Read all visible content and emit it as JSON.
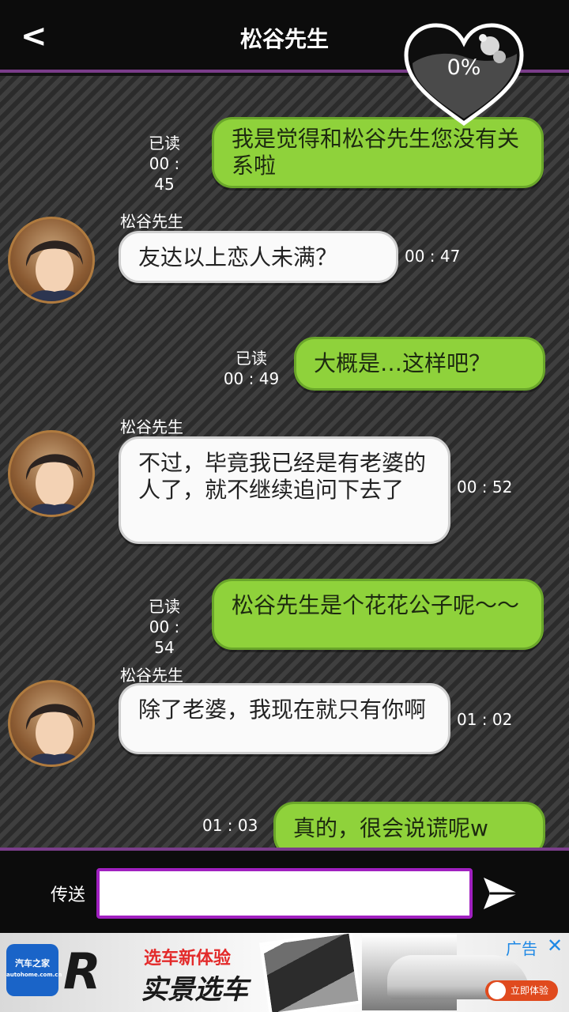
{
  "header": {
    "title": "松谷先生",
    "affection_percent": "0%",
    "affection_value": 0
  },
  "messages": [
    {
      "dir": "out",
      "text": "我是觉得和松谷先生您没有关系啦",
      "read": "已读",
      "time": "00 : 45"
    },
    {
      "dir": "in",
      "sender": "松谷先生",
      "text": "友达以上恋人未满？",
      "time": "00 : 47"
    },
    {
      "dir": "out",
      "text": "大概是…这样吧？",
      "read": "已读",
      "time": "00 : 49"
    },
    {
      "dir": "in",
      "sender": "松谷先生",
      "text": "不过，毕竟我已经是有老婆的人了，就不继续追问下去了",
      "time": "00 : 52"
    },
    {
      "dir": "out",
      "text": "松谷先生是个花花公子呢～～",
      "read": "已读",
      "time": "00 : 54"
    },
    {
      "dir": "in",
      "sender": "松谷先生",
      "text": "除了老婆，我现在就只有你啊",
      "time": "01 : 02"
    },
    {
      "dir": "out",
      "text": "真的，很会说谎呢w",
      "read": "",
      "time": "01 : 03"
    }
  ],
  "input": {
    "send_label": "传送",
    "value": "",
    "placeholder": ""
  },
  "ad": {
    "logo_text": "汽车之家",
    "logo_url_text": "autohome.com.cn",
    "brand_mark": "R",
    "headline": "选车新体验",
    "title": "实景选车",
    "tag": "广告",
    "close": "✕",
    "cta": "立即体验"
  },
  "colors": {
    "accent": "#7a3d8a",
    "input_border": "#a020c0",
    "outgoing_bubble": "#8fd23b",
    "incoming_bubble": "#fafafa"
  }
}
